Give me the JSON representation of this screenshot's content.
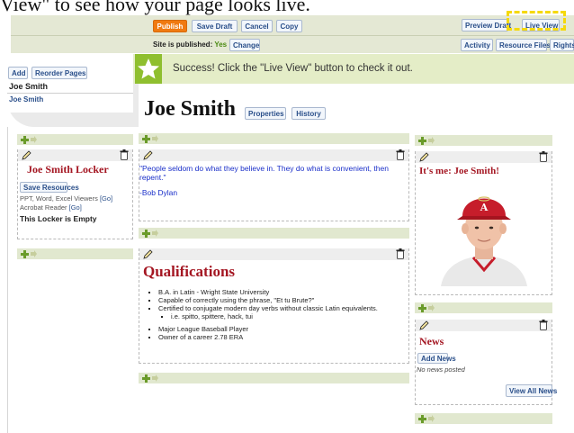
{
  "top_caption": "View\" to see how your page looks live.",
  "toolbar": {
    "publish": "Publish",
    "save_draft": "Save Draft",
    "cancel": "Cancel",
    "copy": "Copy",
    "preview_draft": "Preview Draft",
    "live_view": "Live View",
    "published_label": "Site is published:",
    "published_value": "Yes",
    "change": "Change",
    "activity": "Activity",
    "resource_files": "Resource Files",
    "rights": "Rights"
  },
  "sidebar": {
    "add": "Add",
    "reorder": "Reorder Pages",
    "heading": "Joe Smith",
    "link": "Joe Smith"
  },
  "success": {
    "message": "Success! Click the \"Live View\" button to check it out."
  },
  "page": {
    "title": "Joe Smith",
    "properties": "Properties",
    "history": "History"
  },
  "locker": {
    "title": "Joe Smith Locker",
    "save_resources": "Save Resources",
    "viewers_text": "PPT, Word, Excel Viewers",
    "viewers_go": "[Go]",
    "acrobat_text": "Acrobat Reader",
    "acrobat_go": "[Go]",
    "empty": "This Locker is Empty"
  },
  "quote": {
    "text": "\"People seldom do what they believe in. They do what is convenient, then repent.\"",
    "author": "-Bob Dylan"
  },
  "qualifications": {
    "title": "Qualifications",
    "items": [
      "B.A. in Latin - Wright State University",
      "Capable of correctly using the phrase, \"Et tu Brute?\"",
      "Certified to conjugate modern day verbs without classic Latin equivalents."
    ],
    "subitem": "i.e. spitto, spittere, hack, tui",
    "items2": [
      "Major League Baseball Player",
      "Owner of a career 2.78 ERA"
    ]
  },
  "profile": {
    "title": "It's me: Joe Smith!"
  },
  "news": {
    "title": "News",
    "add": "Add News",
    "empty": "No news posted",
    "view_all": "View All News"
  },
  "colors": {
    "accent_orange": "#f07a11",
    "heading_red": "#a41622",
    "highlight": "#f5d90a"
  }
}
